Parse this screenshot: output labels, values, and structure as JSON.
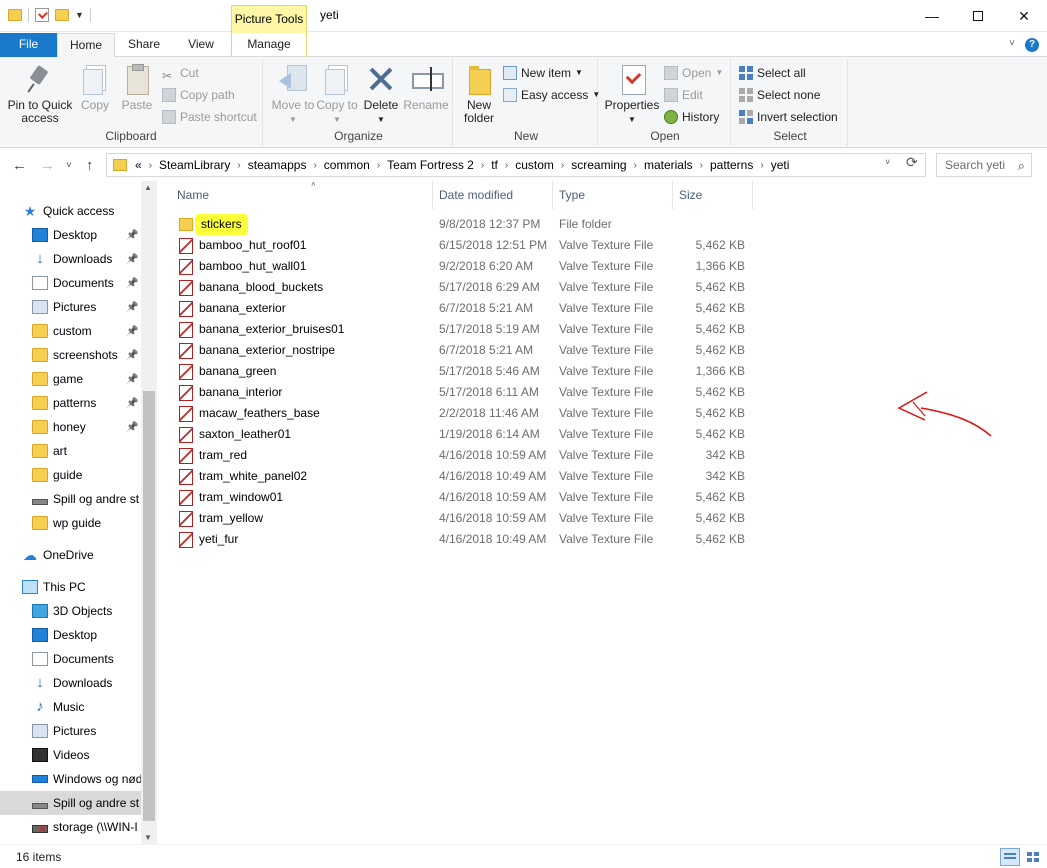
{
  "window": {
    "title": "yeti",
    "context_tab_header": "Picture Tools",
    "minimize_glyph": "—",
    "close_glyph": "✕"
  },
  "tabs": {
    "file": "File",
    "home": "Home",
    "share": "Share",
    "view": "View",
    "manage": "Manage"
  },
  "ribbon": {
    "clipboard": {
      "label": "Clipboard",
      "pin": "Pin to Quick access",
      "copy": "Copy",
      "paste": "Paste",
      "cut": "Cut",
      "copy_path": "Copy path",
      "paste_shortcut": "Paste shortcut"
    },
    "organize": {
      "label": "Organize",
      "move_to": "Move to",
      "copy_to": "Copy to",
      "delete": "Delete",
      "rename": "Rename"
    },
    "new": {
      "label": "New",
      "new_folder": "New folder",
      "new_item": "New item",
      "easy_access": "Easy access"
    },
    "open": {
      "label": "Open",
      "properties": "Properties",
      "open": "Open",
      "edit": "Edit",
      "history": "History"
    },
    "select": {
      "label": "Select",
      "select_all": "Select all",
      "select_none": "Select none",
      "invert_selection": "Invert selection"
    }
  },
  "address": {
    "overflow": "«",
    "crumbs": [
      "SteamLibrary",
      "steamapps",
      "common",
      "Team Fortress 2",
      "tf",
      "custom",
      "screaming",
      "materials",
      "patterns",
      "yeti"
    ],
    "search_placeholder": "Search yeti"
  },
  "nav": {
    "quick_access": "Quick access",
    "quick_items": [
      {
        "label": "Desktop",
        "icon": "desktop-icon"
      },
      {
        "label": "Downloads",
        "icon": "downloads-icon"
      },
      {
        "label": "Documents",
        "icon": "documents-icon"
      },
      {
        "label": "Pictures",
        "icon": "pictures-icon"
      },
      {
        "label": "custom",
        "icon": "folder-icon"
      },
      {
        "label": "screenshots",
        "icon": "folder-icon"
      },
      {
        "label": "game",
        "icon": "folder-icon"
      },
      {
        "label": "patterns",
        "icon": "folder-icon"
      },
      {
        "label": "honey",
        "icon": "folder-icon"
      },
      {
        "label": "art",
        "icon": "folder-icon"
      },
      {
        "label": "guide",
        "icon": "folder-icon"
      },
      {
        "label": "Spill og andre st",
        "icon": "drive-icon"
      },
      {
        "label": "wp guide",
        "icon": "folder-icon"
      }
    ],
    "onedrive": "OneDrive",
    "this_pc": "This PC",
    "pc_items": [
      {
        "label": "3D Objects",
        "icon": "3d-objects-icon"
      },
      {
        "label": "Desktop",
        "icon": "desktop-icon"
      },
      {
        "label": "Documents",
        "icon": "documents-icon"
      },
      {
        "label": "Downloads",
        "icon": "downloads-icon"
      },
      {
        "label": "Music",
        "icon": "music-icon"
      },
      {
        "label": "Pictures",
        "icon": "pictures-icon"
      },
      {
        "label": "Videos",
        "icon": "videos-icon"
      },
      {
        "label": "Windows og nød",
        "icon": "windows-drive-icon"
      },
      {
        "label": "Spill og andre st",
        "icon": "drive-icon"
      },
      {
        "label": "storage (\\\\WIN-I",
        "icon": "network-drive-icon"
      }
    ]
  },
  "columns": {
    "name": "Name",
    "date": "Date modified",
    "type": "Type",
    "size": "Size"
  },
  "files": [
    {
      "name": "stickers",
      "date": "9/8/2018 12:37 PM",
      "type": "File folder",
      "size": ""
    },
    {
      "name": "bamboo_hut_roof01",
      "date": "6/15/2018 12:51 PM",
      "type": "Valve Texture File",
      "size": "5,462 KB"
    },
    {
      "name": "bamboo_hut_wall01",
      "date": "9/2/2018 6:20 AM",
      "type": "Valve Texture File",
      "size": "1,366 KB"
    },
    {
      "name": "banana_blood_buckets",
      "date": "5/17/2018 6:29 AM",
      "type": "Valve Texture File",
      "size": "5,462 KB"
    },
    {
      "name": "banana_exterior",
      "date": "6/7/2018 5:21 AM",
      "type": "Valve Texture File",
      "size": "5,462 KB"
    },
    {
      "name": "banana_exterior_bruises01",
      "date": "5/17/2018 5:19 AM",
      "type": "Valve Texture File",
      "size": "5,462 KB"
    },
    {
      "name": "banana_exterior_nostripe",
      "date": "6/7/2018 5:21 AM",
      "type": "Valve Texture File",
      "size": "5,462 KB"
    },
    {
      "name": "banana_green",
      "date": "5/17/2018 5:46 AM",
      "type": "Valve Texture File",
      "size": "1,366 KB"
    },
    {
      "name": "banana_interior",
      "date": "5/17/2018 6:11 AM",
      "type": "Valve Texture File",
      "size": "5,462 KB"
    },
    {
      "name": "macaw_feathers_base",
      "date": "2/2/2018 11:46 AM",
      "type": "Valve Texture File",
      "size": "5,462 KB"
    },
    {
      "name": "saxton_leather01",
      "date": "1/19/2018 6:14 AM",
      "type": "Valve Texture File",
      "size": "5,462 KB"
    },
    {
      "name": "tram_red",
      "date": "4/16/2018 10:59 AM",
      "type": "Valve Texture File",
      "size": "342 KB"
    },
    {
      "name": "tram_white_panel02",
      "date": "4/16/2018 10:49 AM",
      "type": "Valve Texture File",
      "size": "342 KB"
    },
    {
      "name": "tram_window01",
      "date": "4/16/2018 10:59 AM",
      "type": "Valve Texture File",
      "size": "5,462 KB"
    },
    {
      "name": "tram_yellow",
      "date": "4/16/2018 10:59 AM",
      "type": "Valve Texture File",
      "size": "5,462 KB"
    },
    {
      "name": "yeti_fur",
      "date": "4/16/2018 10:49 AM",
      "type": "Valve Texture File",
      "size": "5,462 KB"
    }
  ],
  "status": {
    "item_count": "16 items"
  },
  "colors": {
    "file_tab": "#1979ca",
    "context_tab": "#fdf7a6",
    "highlight": "#fbff3a",
    "annotation": "#e01010"
  }
}
